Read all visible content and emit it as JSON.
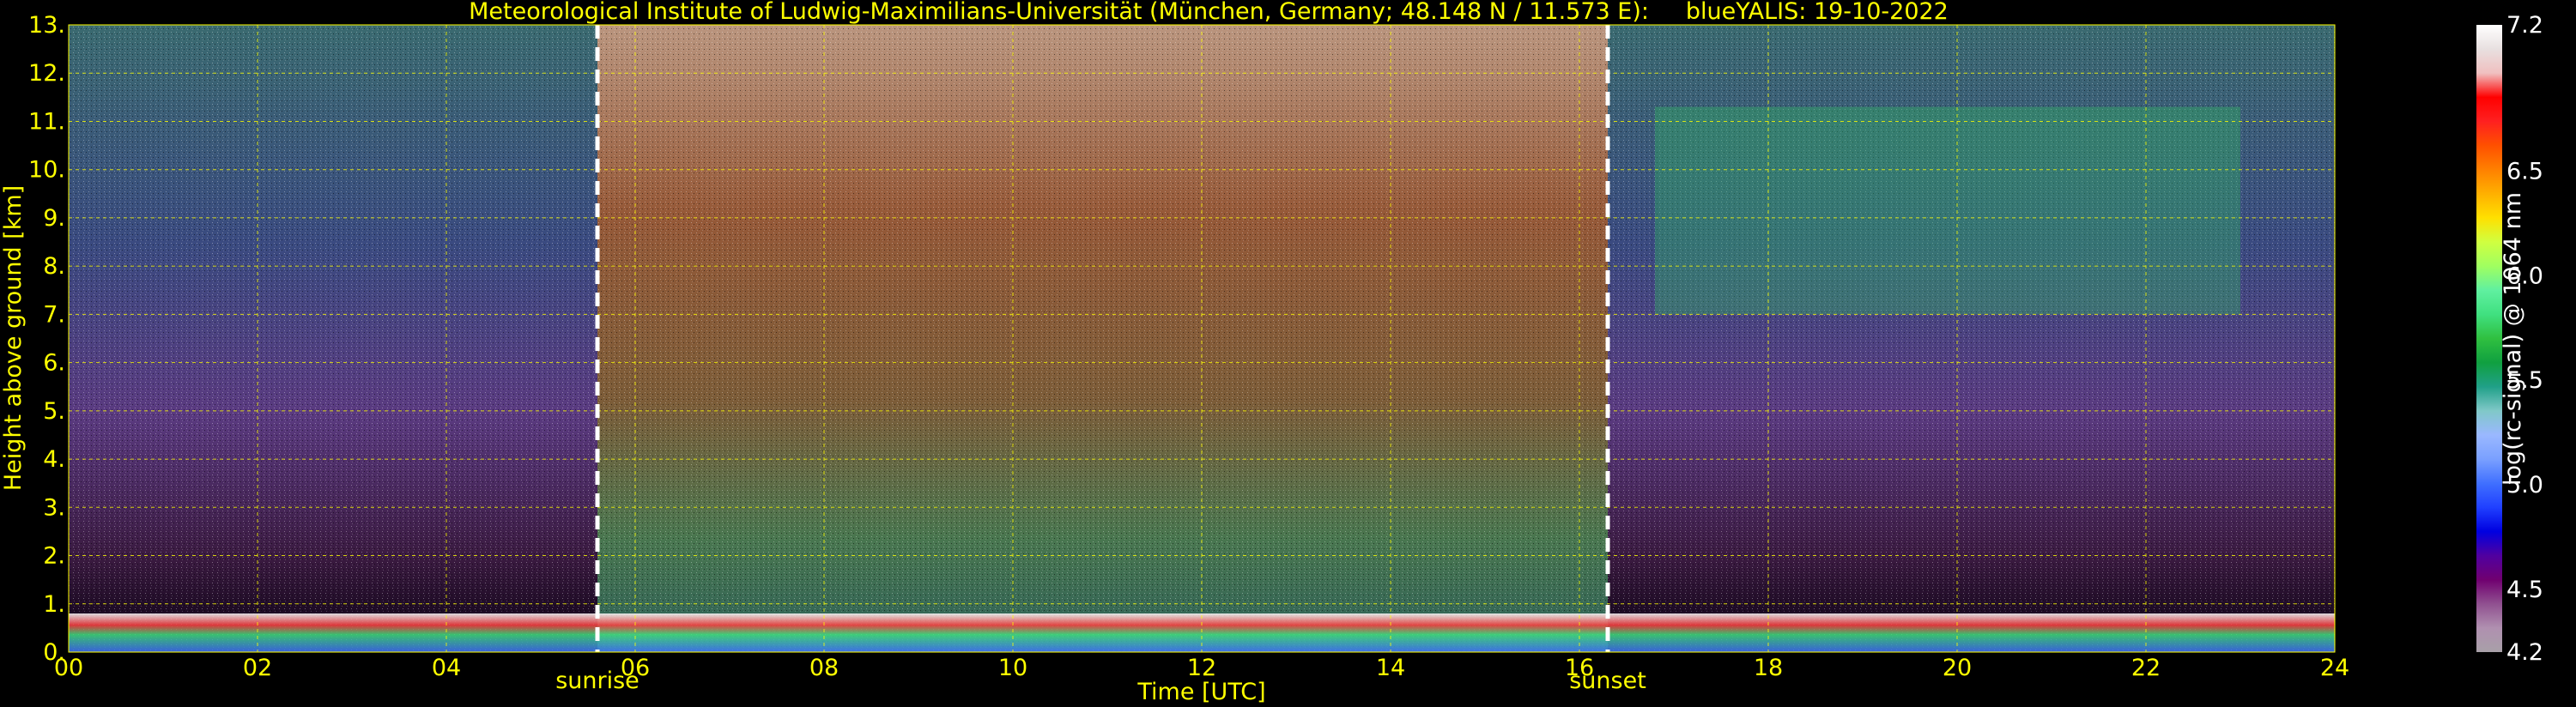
{
  "chart_data": {
    "type": "heatmap",
    "title": "Meteorological Institute of Ludwig-Maximilians-Universität (München, Germany; 48.148 N / 11.573 E):     blueYALIS: 19-10-2022",
    "xlabel": "Time [UTC]",
    "ylabel": "Height above ground [km]",
    "xlim": [
      0,
      24
    ],
    "ylim": [
      0,
      13
    ],
    "x_ticks": [
      "00",
      "02",
      "04",
      "06",
      "08",
      "10",
      "12",
      "14",
      "16",
      "18",
      "20",
      "22",
      "24"
    ],
    "y_ticks": [
      "0.",
      "1.",
      "2.",
      "3.",
      "4.",
      "5.",
      "6.",
      "7.",
      "8.",
      "9.",
      "10.",
      "11.",
      "12.",
      "13."
    ],
    "grid": true,
    "annotations": [
      {
        "label": "sunrise",
        "x": 5.6
      },
      {
        "label": "sunset",
        "x": 16.3
      }
    ],
    "colorbar": {
      "label": "log(rc-signal) @ 1064 nm",
      "range": [
        4.2,
        7.2
      ],
      "tick_labels": [
        "4.2",
        "4.5",
        "5.0",
        "5.5",
        "6.0",
        "6.5",
        "7.2"
      ],
      "ticks": [
        4.2,
        4.5,
        5.0,
        5.5,
        6.0,
        6.5,
        7.2
      ],
      "colors": [
        "#a8a0a8",
        "#b090b0",
        "#905090",
        "#700070",
        "#5000a0",
        "#0000e0",
        "#2040ff",
        "#4070ff",
        "#7aa0ff",
        "#9ab8ff",
        "#80c8c8",
        "#20a088",
        "#10a040",
        "#30c040",
        "#40e080",
        "#60f0a0",
        "#a0ff60",
        "#d0ff40",
        "#ffe000",
        "#ffb000",
        "#ff8000",
        "#ff5000",
        "#ff2020",
        "#ff0000",
        "#f0c0c0",
        "#e8e0e0",
        "#ffffff"
      ]
    },
    "features": [
      {
        "name": "boundary layer",
        "x": [
          0,
          24
        ],
        "height_km": [
          0,
          0.8
        ]
      },
      {
        "name": "cirrus",
        "x": [
          16.8,
          23.0
        ],
        "height_km": [
          7.0,
          11.3
        ]
      }
    ]
  },
  "colors": {
    "axis_text": "#ffff00",
    "grid": "#ffff00",
    "background": "#000000",
    "marker_line": "#ffffff",
    "colorbar_text": "#ffffff"
  }
}
